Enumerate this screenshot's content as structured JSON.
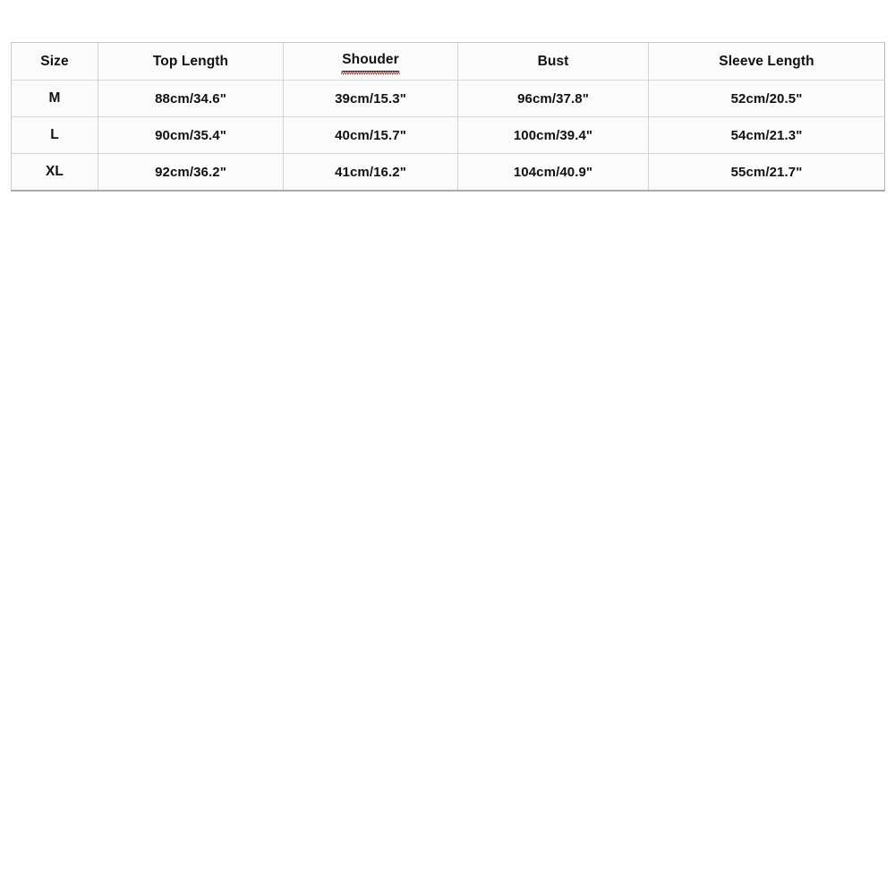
{
  "page": {
    "background_color": "#ffffff",
    "content_type": "product-size-chart"
  },
  "size_chart": {
    "colors": {
      "cell_background": "#fbfbfb",
      "text": "#111111",
      "grid_line": "#d4d4d4",
      "outer_border": "#b9b9b9",
      "spellcheck_underline": "#8a2b2b"
    },
    "columns": [
      {
        "key": "size",
        "label": "Size",
        "misspelled": false
      },
      {
        "key": "top",
        "label": "Top Length",
        "misspelled": false
      },
      {
        "key": "shoulder",
        "label": "Shouder",
        "misspelled": true
      },
      {
        "key": "bust",
        "label": "Bust",
        "misspelled": false
      },
      {
        "key": "sleeve",
        "label": "Sleeve Length",
        "misspelled": false
      }
    ],
    "rows": [
      {
        "size": "M",
        "top": "88cm/34.6\"",
        "shoulder": "39cm/15.3\"",
        "bust": "96cm/37.8\"",
        "sleeve": "52cm/20.5\""
      },
      {
        "size": "L",
        "top": "90cm/35.4\"",
        "shoulder": "40cm/15.7\"",
        "bust": "100cm/39.4\"",
        "sleeve": "54cm/21.3\""
      },
      {
        "size": "XL",
        "top": "92cm/36.2\"",
        "shoulder": "41cm/16.2\"",
        "bust": "104cm/40.9\"",
        "sleeve": "55cm/21.7\""
      }
    ]
  }
}
